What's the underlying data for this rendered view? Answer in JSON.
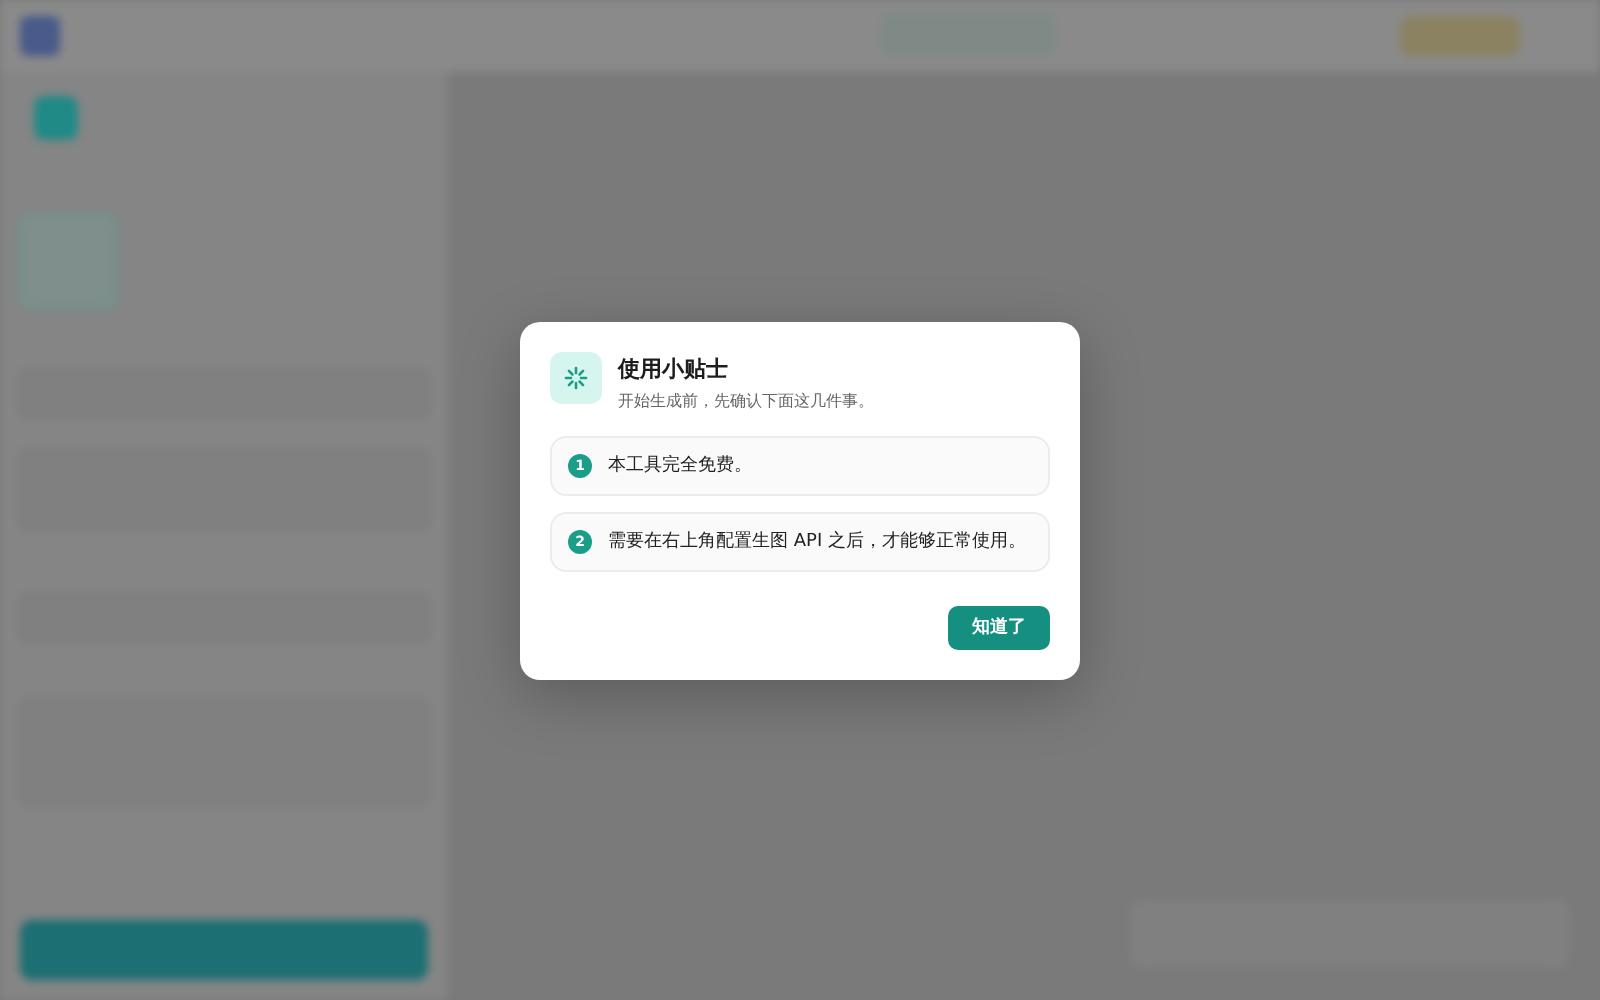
{
  "dialog": {
    "title": "使用小贴士",
    "subtitle": "开始生成前，先确认下面这几件事。",
    "tips": [
      {
        "number": "1",
        "text": "本工具完全免费。"
      },
      {
        "number": "2",
        "text": "需要在右上角配置生图 API 之后，才能够正常使用。"
      }
    ],
    "button": "知道了"
  }
}
